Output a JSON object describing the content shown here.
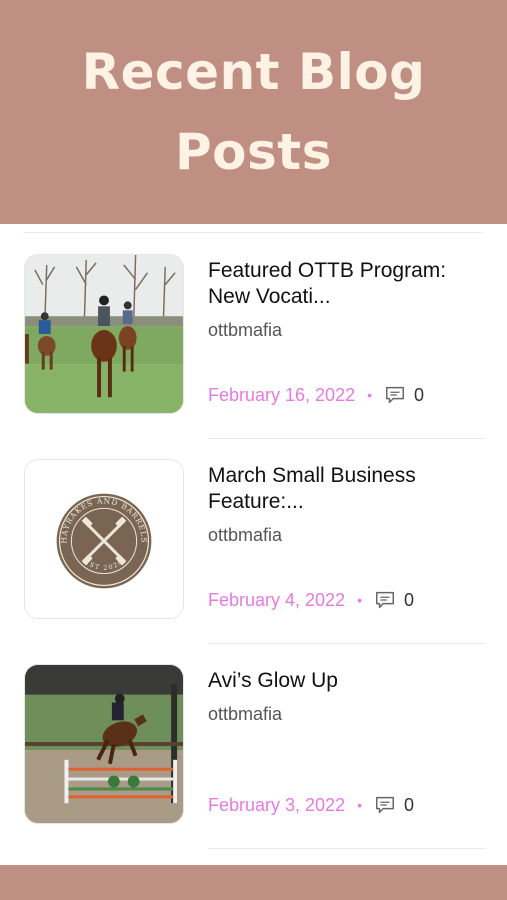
{
  "header": {
    "title": "Recent Blog Posts"
  },
  "colors": {
    "header_bg": "#bf8f83",
    "title_text": "#fdf2e3",
    "date": "#e77ae0"
  },
  "posts": [
    {
      "title": "Featured OTTB Program: New Vocati...",
      "author": "ottbmafia",
      "date": "February 16, 2022",
      "separator": "•",
      "comments": "0",
      "thumbnail": "horses-field-photo"
    },
    {
      "title": "March Small Business Feature:...",
      "author": "ottbmafia",
      "date": "February 4, 2022",
      "separator": "•",
      "comments": "0",
      "thumbnail": "hayrakes-and-barrels-logo"
    },
    {
      "title": "Avi’s Glow Up",
      "author": "ottbmafia",
      "date": "February 3, 2022",
      "separator": "•",
      "comments": "0",
      "thumbnail": "horse-jumping-photo"
    }
  ],
  "logo_text": {
    "top": "HAYRAKES AND BARRELS",
    "bottom": "EST 2020"
  }
}
